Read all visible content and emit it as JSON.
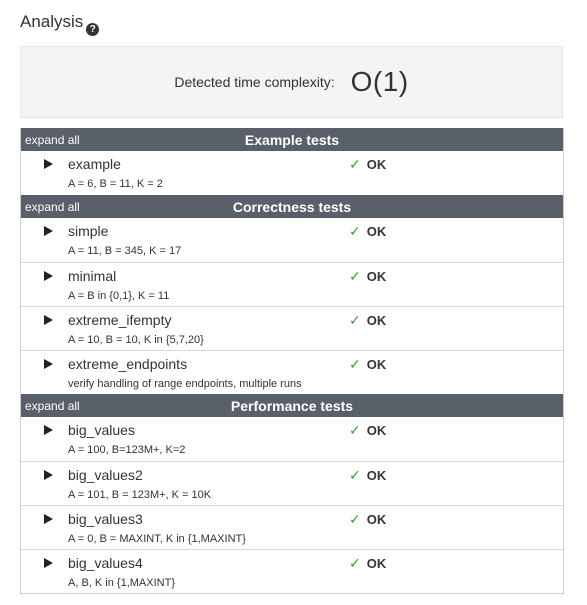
{
  "analysis": {
    "title": "Analysis",
    "help_icon": "?",
    "complexity_label": "Detected time complexity:",
    "complexity_value": "O(1)"
  },
  "groups": [
    {
      "expand_label": "expand all",
      "title": "Example tests",
      "tests": [
        {
          "name": "example",
          "desc": "A = 6, B = 11, K = 2",
          "result": "OK"
        }
      ]
    },
    {
      "expand_label": "expand all",
      "title": "Correctness tests",
      "tests": [
        {
          "name": "simple",
          "desc": "A = 11, B = 345, K = 17",
          "result": "OK"
        },
        {
          "name": "minimal",
          "desc": "A = B in {0,1}, K = 11",
          "result": "OK"
        },
        {
          "name": "extreme_ifempty",
          "desc": "A = 10, B = 10, K in {5,7,20}",
          "result": "OK"
        },
        {
          "name": "extreme_endpoints",
          "desc": "verify handling of range endpoints, multiple runs",
          "result": "OK"
        }
      ]
    },
    {
      "expand_label": "expand all",
      "title": "Performance tests",
      "tests": [
        {
          "name": "big_values",
          "desc": "A = 100, B=123M+, K=2",
          "result": "OK"
        },
        {
          "name": "big_values2",
          "desc": "A = 101, B = 123M+, K = 10K",
          "result": "OK"
        },
        {
          "name": "big_values3",
          "desc": "A = 0, B = MAXINT, K in {1,MAXINT}",
          "result": "OK"
        },
        {
          "name": "big_values4",
          "desc": "A, B, K in {1,MAXINT}",
          "result": "OK"
        }
      ]
    }
  ],
  "icons": {
    "expand_row": "play-triangle-icon",
    "pass": "check-icon",
    "check_glyph": "✓",
    "help": "help-circle-icon"
  },
  "colors": {
    "header_bg": "#5a6069",
    "check": "#3a9a3a",
    "panel_bg": "#f3f4f5"
  }
}
